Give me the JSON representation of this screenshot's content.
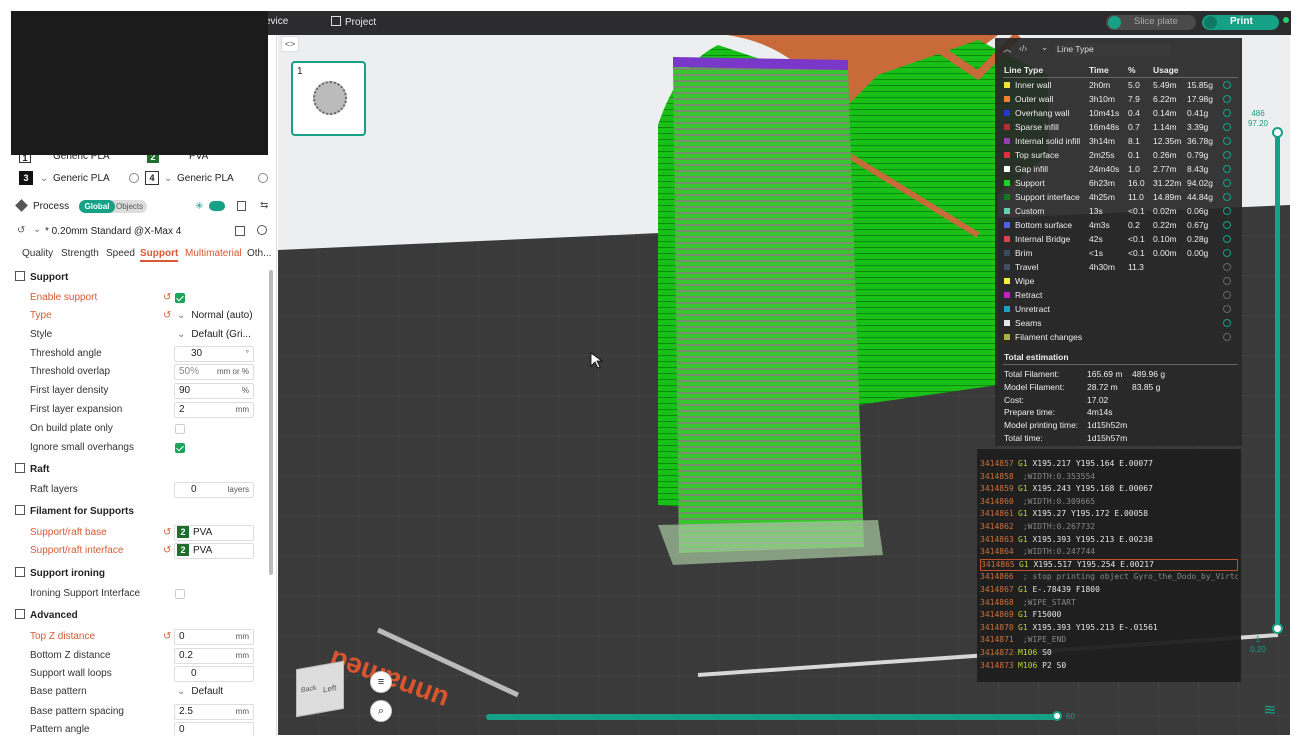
{
  "topbar": {
    "device_label": "evice",
    "project_label": "Project",
    "slice_label": "Slice plate",
    "print_label": "Print"
  },
  "plate": {
    "number": "1"
  },
  "filaments": [
    {
      "index": "1",
      "name": "Generic PLA"
    },
    {
      "index": "2",
      "name": "PVA"
    },
    {
      "index": "3",
      "name": "Generic PLA"
    },
    {
      "index": "4",
      "name": "Generic PLA"
    }
  ],
  "process": {
    "title": "Process",
    "global_label": "Global",
    "objects_label": "Objects",
    "preset": "* 0.20mm Standard @X-Max 4"
  },
  "tabs": [
    "Quality",
    "Strength",
    "Speed",
    "Support",
    "Multimaterial",
    "Oth..."
  ],
  "sections": {
    "support": "Support",
    "raft": "Raft",
    "filament_for_supports": "Filament for Supports",
    "support_ironing": "Support ironing",
    "advanced": "Advanced"
  },
  "settings": {
    "enable_support": "Enable support",
    "type_label": "Type",
    "type_value": "Normal (auto)",
    "style_label": "Style",
    "style_value": "Default (Gri...",
    "threshold_angle_label": "Threshold angle",
    "threshold_angle_value": "30",
    "threshold_angle_unit": "°",
    "threshold_overlap_label": "Threshold overlap",
    "threshold_overlap_value": "50%",
    "threshold_overlap_unit": "mm or %",
    "first_layer_density_label": "First layer density",
    "first_layer_density_value": "90",
    "first_layer_density_unit": "%",
    "first_layer_expansion_label": "First layer expansion",
    "first_layer_expansion_value": "2",
    "first_layer_expansion_unit": "mm",
    "on_build_plate_label": "On build plate only",
    "ignore_small_label": "Ignore small overhangs",
    "raft_layers_label": "Raft layers",
    "raft_layers_value": "0",
    "raft_layers_unit": "layers",
    "support_raft_base_label": "Support/raft base",
    "support_raft_base_idx": "2",
    "support_raft_base_value": "PVA",
    "support_raft_interface_label": "Support/raft interface",
    "support_raft_interface_idx": "2",
    "support_raft_interface_value": "PVA",
    "ironing_interface_label": "Ironing Support Interface",
    "top_z_label": "Top Z distance",
    "top_z_value": "0",
    "top_z_unit": "mm",
    "bottom_z_label": "Bottom Z distance",
    "bottom_z_value": "0.2",
    "bottom_z_unit": "mm",
    "wall_loops_label": "Support wall loops",
    "wall_loops_value": "0",
    "base_pattern_label": "Base pattern",
    "base_pattern_value": "Default",
    "base_spacing_label": "Base pattern spacing",
    "base_spacing_value": "2.5",
    "base_spacing_unit": "mm",
    "pattern_angle_label": "Pattern angle",
    "pattern_angle_value": "0"
  },
  "legend": {
    "dropdown": "Line Type",
    "headers": {
      "name": "Line Type",
      "time": "Time",
      "pct": "%",
      "usage": "Usage"
    },
    "rows": [
      {
        "name": "Inner wall",
        "time": "2h0m",
        "pct": "5.0",
        "m": "5.49m",
        "g": "15.85g",
        "color": "#f0e43c",
        "eye": true
      },
      {
        "name": "Outer wall",
        "time": "3h10m",
        "pct": "7.9",
        "m": "6.22m",
        "g": "17.98g",
        "color": "#f08030",
        "eye": true
      },
      {
        "name": "Overhang wall",
        "time": "10m41s",
        "pct": "0.4",
        "m": "0.14m",
        "g": "0.41g",
        "color": "#2038d0",
        "eye": true
      },
      {
        "name": "Sparse infill",
        "time": "16m48s",
        "pct": "0.7",
        "m": "1.14m",
        "g": "3.39g",
        "color": "#b03030",
        "eye": true
      },
      {
        "name": "Internal solid infill",
        "time": "3h14m",
        "pct": "8.1",
        "m": "12.35m",
        "g": "36.78g",
        "color": "#9040b0",
        "eye": true
      },
      {
        "name": "Top surface",
        "time": "2m25s",
        "pct": "0.1",
        "m": "0.26m",
        "g": "0.79g",
        "color": "#e03040",
        "eye": true
      },
      {
        "name": "Gap infill",
        "time": "24m40s",
        "pct": "1.0",
        "m": "2.77m",
        "g": "8.43g",
        "color": "#ffffff",
        "eye": true
      },
      {
        "name": "Support",
        "time": "6h23m",
        "pct": "16.0",
        "m": "31.22m",
        "g": "94.02g",
        "color": "#22d022",
        "eye": true
      },
      {
        "name": "Support interface",
        "time": "4h25m",
        "pct": "11.0",
        "m": "14.89m",
        "g": "44.84g",
        "color": "#127a22",
        "eye": true
      },
      {
        "name": "Custom",
        "time": "13s",
        "pct": "<0.1",
        "m": "0.02m",
        "g": "0.06g",
        "color": "#60d0b0",
        "eye": true
      },
      {
        "name": "Bottom surface",
        "time": "4m3s",
        "pct": "0.2",
        "m": "0.22m",
        "g": "0.67g",
        "color": "#5060e0",
        "eye": true
      },
      {
        "name": "Internal Bridge",
        "time": "42s",
        "pct": "<0.1",
        "m": "0.10m",
        "g": "0.28g",
        "color": "#e04050",
        "eye": true
      },
      {
        "name": "Brim",
        "time": "<1s",
        "pct": "<0.1",
        "m": "0.00m",
        "g": "0.00g",
        "color": "#3a4a60",
        "eye": true
      },
      {
        "name": "Travel",
        "time": "4h30m",
        "pct": "11.3",
        "m": "",
        "g": "",
        "color": "#405060",
        "eye": false
      },
      {
        "name": "Wipe",
        "time": "",
        "pct": "",
        "m": "",
        "g": "",
        "color": "#f4f040",
        "eye": false
      },
      {
        "name": "Retract",
        "time": "",
        "pct": "",
        "m": "",
        "g": "",
        "color": "#c020c0",
        "eye": false
      },
      {
        "name": "Unretract",
        "time": "",
        "pct": "",
        "m": "",
        "g": "",
        "color": "#20a0c0",
        "eye": false
      },
      {
        "name": "Seams",
        "time": "",
        "pct": "",
        "m": "",
        "g": "",
        "color": "#e6e6e6",
        "eye": true
      },
      {
        "name": "Filament changes",
        "time": "",
        "pct": "",
        "m": "",
        "g": "",
        "color": "#b0b040",
        "eye": false
      }
    ],
    "total_title": "Total estimation",
    "totals": [
      {
        "label": "Total Filament:",
        "v1": "165.69 m",
        "v2": "489.96 g"
      },
      {
        "label": "Model Filament:",
        "v1": "28.72 m",
        "v2": "83.85 g"
      },
      {
        "label": "Cost:",
        "v1": "17.02",
        "v2": ""
      },
      {
        "label": "Prepare time:",
        "v1": "4m14s",
        "v2": ""
      },
      {
        "label": "Model printing time:",
        "v1": "1d15h52m",
        "v2": ""
      },
      {
        "label": "Total time:",
        "v1": "1d15h57m",
        "v2": ""
      }
    ]
  },
  "gcode": [
    {
      "n": "3414857",
      "cmd": "G1",
      "rest": "X195.217 Y195.164 E.00077",
      "comment": ""
    },
    {
      "n": "3414858",
      "cmd": "",
      "rest": "",
      "comment": ";WIDTH:0.353554"
    },
    {
      "n": "3414859",
      "cmd": "G1",
      "rest": "X195.243 Y195.168 E.00067",
      "comment": ""
    },
    {
      "n": "3414860",
      "cmd": "",
      "rest": "",
      "comment": ";WIDTH:0.309665"
    },
    {
      "n": "3414861",
      "cmd": "G1",
      "rest": "X195.27 Y195.172 E.00058",
      "comment": ""
    },
    {
      "n": "3414862",
      "cmd": "",
      "rest": "",
      "comment": ";WIDTH:0.267732"
    },
    {
      "n": "3414863",
      "cmd": "G1",
      "rest": "X195.393 Y195.213 E.00238",
      "comment": ""
    },
    {
      "n": "3414864",
      "cmd": "",
      "rest": "",
      "comment": ";WIDTH:0.247744"
    },
    {
      "n": "3414865",
      "cmd": "G1",
      "rest": "X195.517 Y195.254 E.00217",
      "comment": "",
      "current": true
    },
    {
      "n": "3414866",
      "cmd": "",
      "rest": "",
      "comment": "; stop printing object Gyro_the_Dodo_by_Virtox_-_CC-"
    },
    {
      "n": "3414867",
      "cmd": "G1",
      "rest": "E-.78439 F1800",
      "comment": ""
    },
    {
      "n": "3414868",
      "cmd": "",
      "rest": "",
      "comment": ";WIPE_START"
    },
    {
      "n": "3414869",
      "cmd": "G1",
      "rest": "F15000",
      "comment": ""
    },
    {
      "n": "3414870",
      "cmd": "G1",
      "rest": "X195.393 Y195.213 E-.01561",
      "comment": ""
    },
    {
      "n": "3414871",
      "cmd": "",
      "rest": "",
      "comment": ";WIPE_END"
    },
    {
      "n": "3414872",
      "cmd": "M106",
      "rest": "S0",
      "comment": ""
    },
    {
      "n": "3414873",
      "cmd": "M106",
      "rest": "P2 S0",
      "comment": ""
    }
  ],
  "layer_slider": {
    "top_value": "486",
    "top_height": "97.20",
    "bottom_value": "1",
    "bottom_height": "0.20"
  },
  "move_slider": {
    "value": "60"
  },
  "view_cube": {
    "back": "Back",
    "left": "Left"
  },
  "bed_text": "unnamed"
}
